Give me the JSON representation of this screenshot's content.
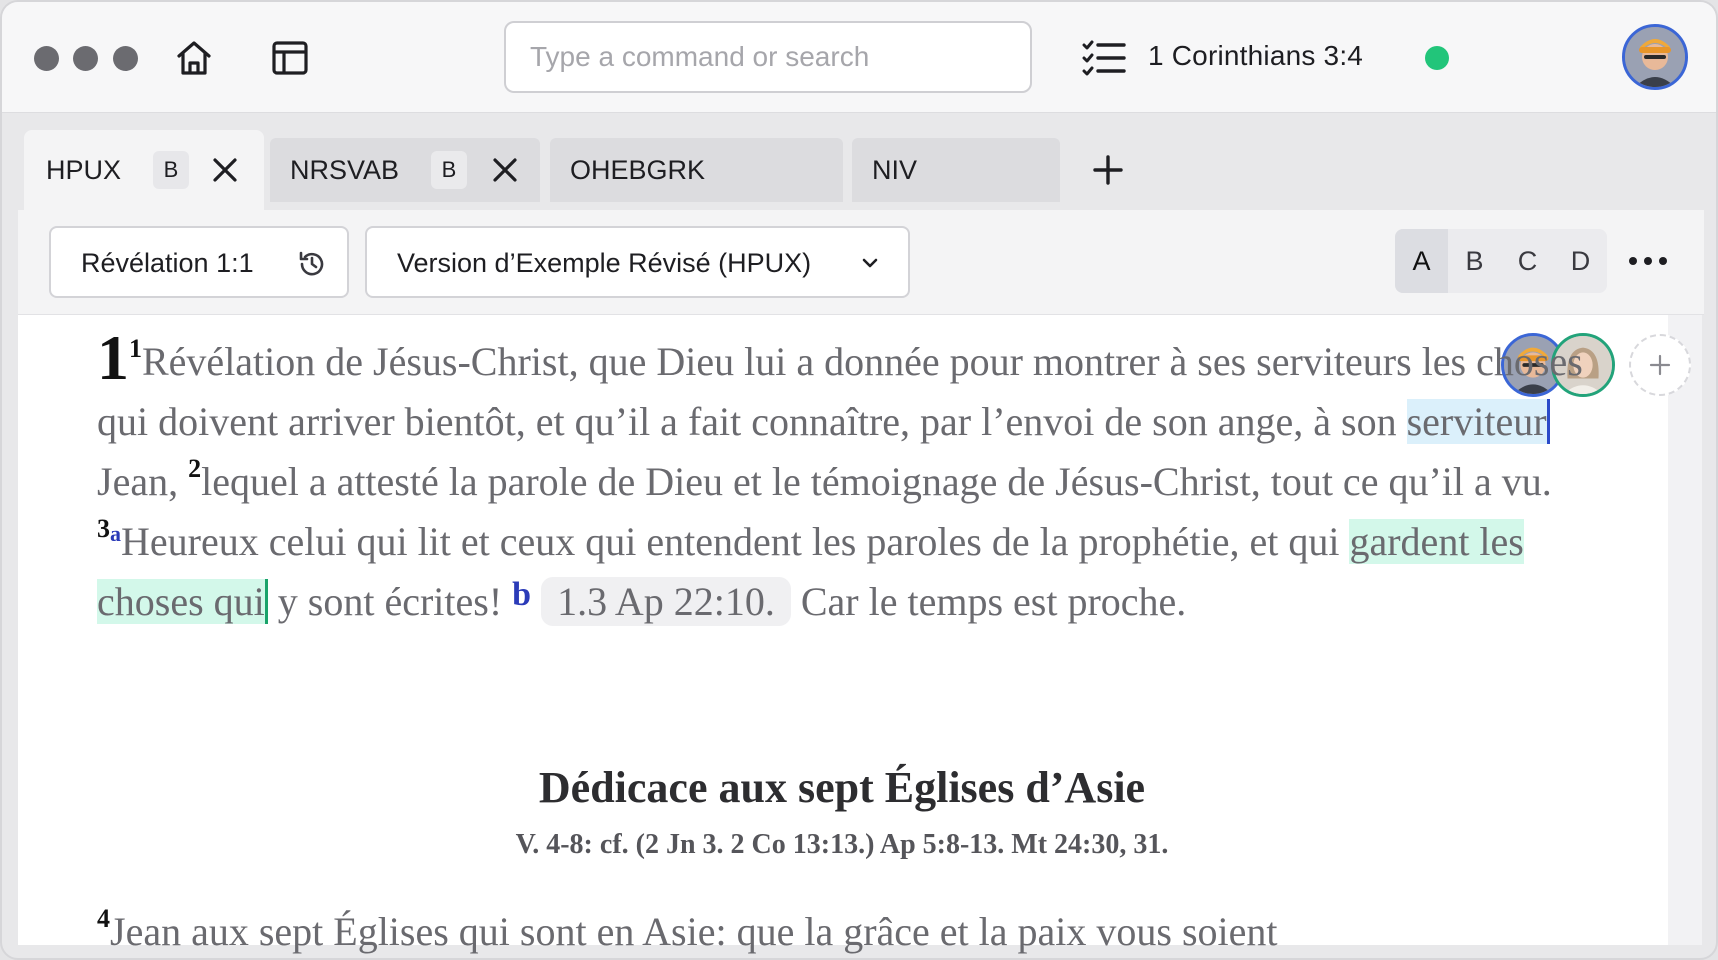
{
  "titlebar": {
    "search_placeholder": "Type a command or search",
    "current_reference": "1 Corinthians 3:4",
    "status_color": "#22c57a"
  },
  "tabs": [
    {
      "label": "HPUX",
      "badge": "B",
      "active": true
    },
    {
      "label": "NRSVAB",
      "badge": "B",
      "active": false
    },
    {
      "label": "OHEBGRK",
      "active": false
    },
    {
      "label": "NIV",
      "active": false
    }
  ],
  "toolbar": {
    "reference": "Révélation 1:1",
    "version": "Version d’Exemple Révisé (HPUX)",
    "segments": [
      "A",
      "B",
      "C",
      "D"
    ],
    "active_segment": "A"
  },
  "passage": {
    "chapter": "1",
    "v1_num": "1",
    "v1_text": "Révélation de Jésus-Christ, que Dieu lui a donnée pour montrer à ses serviteurs les choses qui doivent arriver bientôt, et qu’il a fait connaître, par l’envoi de son ange, à son ",
    "v1_highlight": "serviteur",
    "v1_end": " Jean, ",
    "v2_num": "2",
    "v2_text": "lequel a attesté la parole de Dieu et le témoignage de Jésus-Christ, tout ce qu’il a vu. ",
    "v3_num": "3",
    "v3_fn": "a",
    "v3_text": "Heureux celui qui lit et ceux qui entendent les paroles de la prophétie, et qui ",
    "v3_highlight": "gardent les choses qui",
    "v3_mid": " y sont écrites! ",
    "v3_fn2": "b",
    "v3_xref": "1.3 Ap 22:10.",
    "v3_end": " Car le temps est proche.",
    "heading": "Dédicace aux sept Églises d’Asie",
    "subheading": "V. 4-8: cf. (2 Jn 3. 2 Co 13:13.) Ap 5:8-13. Mt 24:30, 31.",
    "v4_num": "4",
    "v4_text": "Jean aux sept Églises qui sont en Asie: que la grâce et la paix vous soient"
  }
}
